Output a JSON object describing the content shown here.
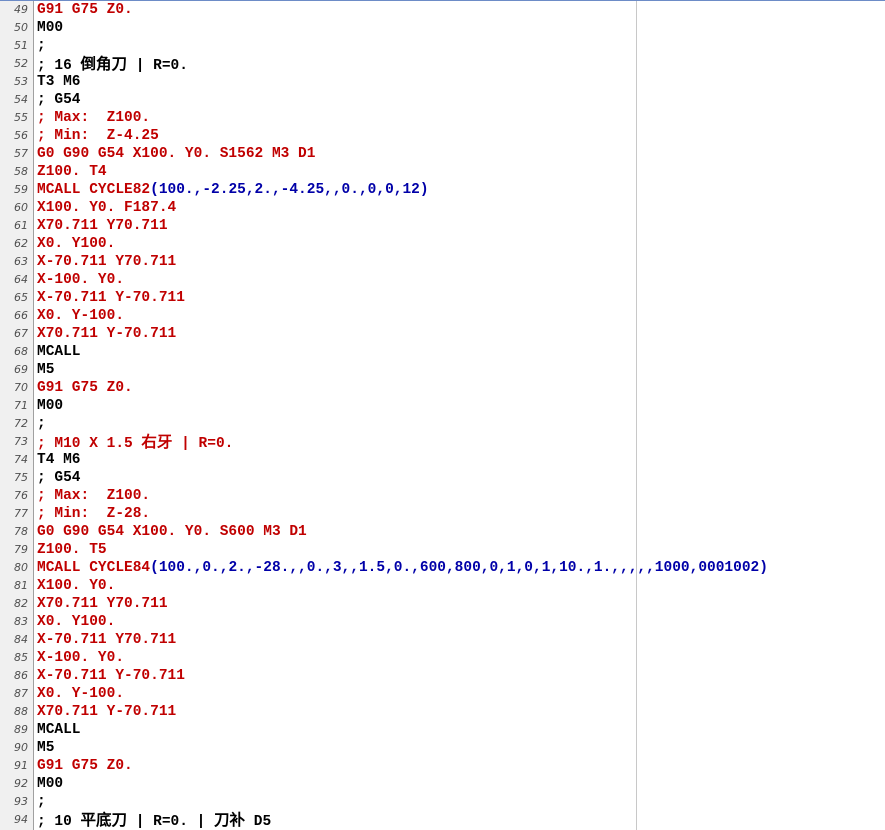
{
  "editor": {
    "lines": [
      {
        "n": "49",
        "segs": [
          {
            "t": "G91 G75 Z0.",
            "c": "red"
          }
        ]
      },
      {
        "n": "50",
        "segs": [
          {
            "t": "M00",
            "c": "black"
          }
        ]
      },
      {
        "n": "51",
        "segs": [
          {
            "t": ";",
            "c": "black"
          }
        ]
      },
      {
        "n": "52",
        "segs": [
          {
            "t": "; 16 ",
            "c": "black"
          },
          {
            "t": "倒角刀",
            "c": "black",
            "cjk": true
          },
          {
            "t": " | R=0.",
            "c": "black"
          }
        ]
      },
      {
        "n": "53",
        "segs": [
          {
            "t": "T3 M6",
            "c": "black"
          }
        ]
      },
      {
        "n": "54",
        "segs": [
          {
            "t": "; G54",
            "c": "black"
          }
        ]
      },
      {
        "n": "55",
        "segs": [
          {
            "t": "; Max:  Z100.",
            "c": "red"
          }
        ]
      },
      {
        "n": "56",
        "segs": [
          {
            "t": "; Min:  Z-4.25",
            "c": "red"
          }
        ]
      },
      {
        "n": "57",
        "segs": [
          {
            "t": "G0 G90 G54 X100. Y0. S1562 M3 D1",
            "c": "red"
          }
        ]
      },
      {
        "n": "58",
        "segs": [
          {
            "t": "Z100. T4",
            "c": "red"
          }
        ]
      },
      {
        "n": "59",
        "segs": [
          {
            "t": "MCALL CYCLE82",
            "c": "red"
          },
          {
            "t": "(100.,-2.25,2.,-4.25,,0.,0,0,12)",
            "c": "blue"
          }
        ]
      },
      {
        "n": "60",
        "segs": [
          {
            "t": "X100. Y0. F187.4",
            "c": "red"
          }
        ]
      },
      {
        "n": "61",
        "segs": [
          {
            "t": "X70.711 Y70.711",
            "c": "red"
          }
        ]
      },
      {
        "n": "62",
        "segs": [
          {
            "t": "X0. Y100.",
            "c": "red"
          }
        ]
      },
      {
        "n": "63",
        "segs": [
          {
            "t": "X-70.711 Y70.711",
            "c": "red"
          }
        ]
      },
      {
        "n": "64",
        "segs": [
          {
            "t": "X-100. Y0.",
            "c": "red"
          }
        ]
      },
      {
        "n": "65",
        "segs": [
          {
            "t": "X-70.711 Y-70.711",
            "c": "red"
          }
        ]
      },
      {
        "n": "66",
        "segs": [
          {
            "t": "X0. Y-100.",
            "c": "red"
          }
        ]
      },
      {
        "n": "67",
        "segs": [
          {
            "t": "X70.711 Y-70.711",
            "c": "red"
          }
        ]
      },
      {
        "n": "68",
        "segs": [
          {
            "t": "MCALL",
            "c": "black"
          }
        ]
      },
      {
        "n": "69",
        "segs": [
          {
            "t": "M5",
            "c": "black"
          }
        ]
      },
      {
        "n": "70",
        "segs": [
          {
            "t": "G91 G75 Z0.",
            "c": "red"
          }
        ]
      },
      {
        "n": "71",
        "segs": [
          {
            "t": "M00",
            "c": "black"
          }
        ]
      },
      {
        "n": "72",
        "segs": [
          {
            "t": ";",
            "c": "black"
          }
        ]
      },
      {
        "n": "73",
        "segs": [
          {
            "t": "; M10 X 1.5 ",
            "c": "red"
          },
          {
            "t": "右牙",
            "c": "red",
            "cjk": true
          },
          {
            "t": " | R=0.",
            "c": "red"
          }
        ]
      },
      {
        "n": "74",
        "segs": [
          {
            "t": "T4 M6",
            "c": "black"
          }
        ]
      },
      {
        "n": "75",
        "segs": [
          {
            "t": "; G54",
            "c": "black"
          }
        ]
      },
      {
        "n": "76",
        "segs": [
          {
            "t": "; Max:  Z100.",
            "c": "red"
          }
        ]
      },
      {
        "n": "77",
        "segs": [
          {
            "t": "; Min:  Z-28.",
            "c": "red"
          }
        ]
      },
      {
        "n": "78",
        "segs": [
          {
            "t": "G0 G90 G54 X100. Y0. S600 M3 D1",
            "c": "red"
          }
        ]
      },
      {
        "n": "79",
        "segs": [
          {
            "t": "Z100. T5",
            "c": "red"
          }
        ]
      },
      {
        "n": "80",
        "segs": [
          {
            "t": "MCALL CYCLE84",
            "c": "red"
          },
          {
            "t": "(100.,0.,2.,-28.,,0.,3,,1.5,0.,600,800,0,1,0,1,10.,1.,,,,,1000,0001002)",
            "c": "blue"
          }
        ]
      },
      {
        "n": "81",
        "segs": [
          {
            "t": "X100. Y0.",
            "c": "red"
          }
        ]
      },
      {
        "n": "82",
        "segs": [
          {
            "t": "X70.711 Y70.711",
            "c": "red"
          }
        ]
      },
      {
        "n": "83",
        "segs": [
          {
            "t": "X0. Y100.",
            "c": "red"
          }
        ]
      },
      {
        "n": "84",
        "segs": [
          {
            "t": "X-70.711 Y70.711",
            "c": "red"
          }
        ]
      },
      {
        "n": "85",
        "segs": [
          {
            "t": "X-100. Y0.",
            "c": "red"
          }
        ]
      },
      {
        "n": "86",
        "segs": [
          {
            "t": "X-70.711 Y-70.711",
            "c": "red"
          }
        ]
      },
      {
        "n": "87",
        "segs": [
          {
            "t": "X0. Y-100.",
            "c": "red"
          }
        ]
      },
      {
        "n": "88",
        "segs": [
          {
            "t": "X70.711 Y-70.711",
            "c": "red"
          }
        ]
      },
      {
        "n": "89",
        "segs": [
          {
            "t": "MCALL",
            "c": "black"
          }
        ]
      },
      {
        "n": "90",
        "segs": [
          {
            "t": "M5",
            "c": "black"
          }
        ]
      },
      {
        "n": "91",
        "segs": [
          {
            "t": "G91 G75 Z0.",
            "c": "red"
          }
        ]
      },
      {
        "n": "92",
        "segs": [
          {
            "t": "M00",
            "c": "black"
          }
        ]
      },
      {
        "n": "93",
        "segs": [
          {
            "t": ";",
            "c": "black"
          }
        ]
      },
      {
        "n": "94",
        "segs": [
          {
            "t": "; 10 ",
            "c": "black"
          },
          {
            "t": "平底刀",
            "c": "black",
            "cjk": true
          },
          {
            "t": " | R=0. | ",
            "c": "black"
          },
          {
            "t": "刀补",
            "c": "black",
            "cjk": true
          },
          {
            "t": " D5",
            "c": "black"
          }
        ]
      }
    ]
  }
}
